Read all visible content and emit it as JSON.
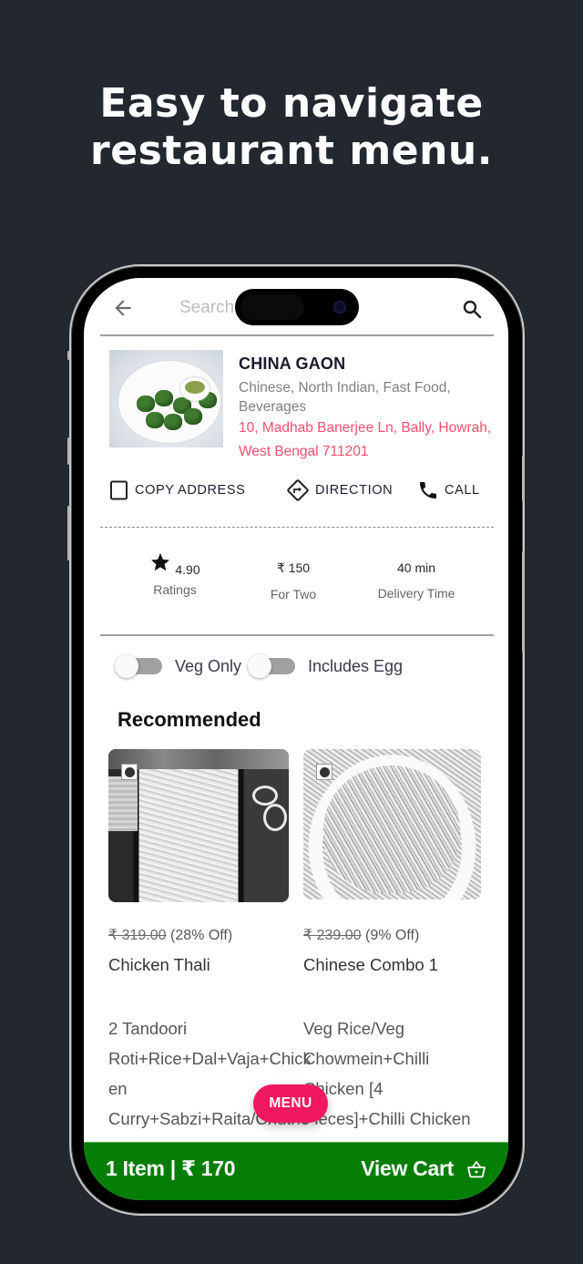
{
  "headline": {
    "line1": "Easy to navigate",
    "line2": "restaurant menu."
  },
  "search": {
    "placeholder": "Search Places",
    "back_icon": "arrow-left-icon",
    "search_icon": "magnifier-icon"
  },
  "restaurant": {
    "name": "CHINA GAON",
    "cuisine": "Chinese, North Indian, Fast Food, Beverages",
    "address": "10, Madhab Banerjee Ln, Bally, Howrah, West Bengal 711201",
    "address_color": "#f0506e"
  },
  "actions": [
    {
      "label": "COPY ADDRESS",
      "icon": "copy-square-icon"
    },
    {
      "label": "DIRECTION",
      "icon": "direction-sign-icon"
    },
    {
      "label": "CALL",
      "icon": "phone-icon"
    }
  ],
  "stats": {
    "rating": {
      "value": "4.90",
      "label": "Ratings",
      "icon": "star-icon"
    },
    "cost": {
      "value": "₹ 150",
      "label": "For Two"
    },
    "delivery": {
      "value": "40 min",
      "label": "Delivery Time"
    }
  },
  "filters": [
    {
      "label": "Veg Only",
      "on": false
    },
    {
      "label": "Includes Egg",
      "on": false
    }
  ],
  "recommended": {
    "title": "Recommended",
    "items": [
      {
        "name": "Chicken Thali",
        "original_price": "₹ 319.00",
        "discount": "(28% Off)",
        "description": "2 Tandoori Roti+Rice+Dal+Vaja+Chicken Curry+Sabzi+Raita/Chutney [Subject to Availability]"
      },
      {
        "name": "Chinese Combo 1",
        "original_price": "₹ 239.00",
        "discount": "(9% Off)",
        "description": "Veg Rice/Veg Chowmein+Chilli Chicken [4 Pieces]+Chilli Chicken"
      }
    ]
  },
  "menu_button": {
    "label": "MENU",
    "color": "#f0185f"
  },
  "cart": {
    "summary": "1 Item | ₹ 170",
    "action_label": "View Cart",
    "icon": "basket-icon",
    "color": "#047e04"
  }
}
